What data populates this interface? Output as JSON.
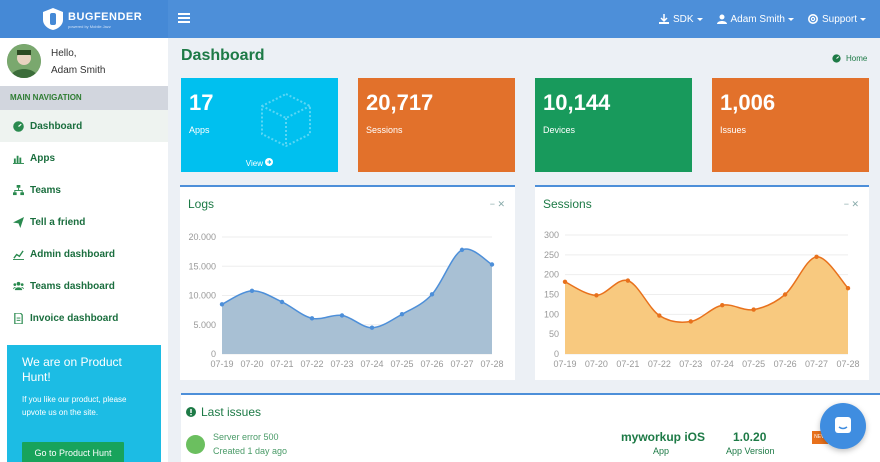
{
  "header": {
    "brand": "BUGFENDER",
    "tagline": "powered by Mobile Jazz",
    "nav": [
      {
        "icon": "download-icon",
        "label": "SDK"
      },
      {
        "icon": "user-icon",
        "label": "Adam Smith"
      },
      {
        "icon": "lifebuoy-icon",
        "label": "Support"
      }
    ]
  },
  "sidebar": {
    "greeting": "Hello,",
    "username": "Adam Smith",
    "nav_header": "MAIN NAVIGATION",
    "items": [
      {
        "label": "Dashboard",
        "icon": "dashboard-icon",
        "active": true
      },
      {
        "label": "Apps",
        "icon": "bar-chart-icon"
      },
      {
        "label": "Teams",
        "icon": "sitemap-icon"
      },
      {
        "label": "Tell a friend",
        "icon": "paper-plane-icon"
      },
      {
        "label": "Admin dashboard",
        "icon": "line-chart-icon"
      },
      {
        "label": "Teams dashboard",
        "icon": "users-icon"
      },
      {
        "label": "Invoice dashboard",
        "icon": "file-icon"
      }
    ],
    "promo": {
      "title": "We are on Product Hunt!",
      "text": "If you like our product, please upvote us on the site.",
      "button": "Go to Product Hunt"
    }
  },
  "page": {
    "title": "Dashboard",
    "breadcrumb": "Home"
  },
  "stats": [
    {
      "value": "17",
      "label": "Apps",
      "color": "#00c0ef",
      "more": "View"
    },
    {
      "value": "20,717",
      "label": "Sessions",
      "color": "#e2712b"
    },
    {
      "value": "10,144",
      "label": "Devices",
      "color": "#189a5c"
    },
    {
      "value": "1,006",
      "label": "Issues",
      "color": "#e2712b"
    }
  ],
  "boxes": {
    "logs_title": "Logs",
    "sessions_title": "Sessions",
    "tools": "− ✕"
  },
  "chart_data": [
    {
      "type": "area",
      "title": "Logs",
      "categories": [
        "07-19",
        "07-20",
        "07-21",
        "07-22",
        "07-23",
        "07-24",
        "07-25",
        "07-26",
        "07-27",
        "07-28"
      ],
      "values": [
        8500,
        10800,
        8900,
        6100,
        6600,
        4500,
        6800,
        10200,
        17800,
        15300
      ],
      "ylim": [
        0,
        20000
      ],
      "yticks": [
        "20.000",
        "15.000",
        "10.000",
        "5.000",
        "0"
      ],
      "color": "#4d8fd9",
      "fill": "#a8c0d4"
    },
    {
      "type": "area",
      "title": "Sessions",
      "categories": [
        "07-19",
        "07-20",
        "07-21",
        "07-22",
        "07-23",
        "07-24",
        "07-25",
        "07-26",
        "07-27",
        "07-28"
      ],
      "values": [
        182,
        148,
        185,
        97,
        82,
        123,
        112,
        150,
        245,
        166
      ],
      "ylim": [
        0,
        300
      ],
      "yticks": [
        "300",
        "250",
        "200",
        "150",
        "100",
        "50",
        "0"
      ],
      "color": "#e8711c",
      "fill": "#f8c97f"
    }
  ],
  "issues": {
    "title": "Last issues",
    "rows": [
      {
        "name": "Server error 500",
        "date": "Created 1 day ago",
        "app": "myworkup iOS",
        "app_label": "App",
        "version": "1.0.20",
        "version_label": "App Version",
        "badge": "NEW"
      }
    ]
  }
}
